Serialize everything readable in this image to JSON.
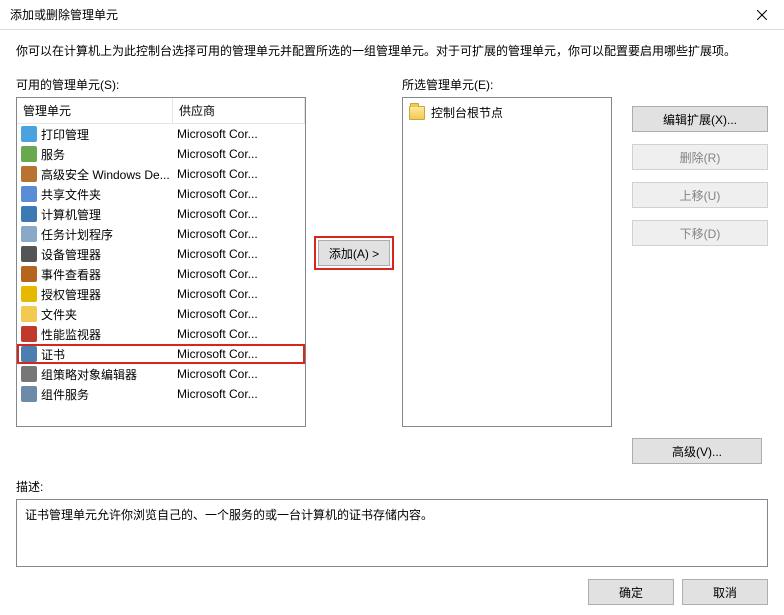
{
  "title": "添加或删除管理单元",
  "intro": "你可以在计算机上为此控制台选择可用的管理单元并配置所选的一组管理单元。对于可扩展的管理单元，你可以配置要启用哪些扩展项。",
  "available_label": "可用的管理单元(S):",
  "selected_label": "所选管理单元(E):",
  "columns": {
    "name": "管理单元",
    "vendor": "供应商"
  },
  "snapins": [
    {
      "name": "打印管理",
      "vendor": "Microsoft Cor...",
      "iconColor": "#4aa3df",
      "selected": false
    },
    {
      "name": "服务",
      "vendor": "Microsoft Cor...",
      "iconColor": "#6aa84f",
      "selected": false
    },
    {
      "name": "高级安全 Windows De...",
      "vendor": "Microsoft Cor...",
      "iconColor": "#b87333",
      "selected": false
    },
    {
      "name": "共享文件夹",
      "vendor": "Microsoft Cor...",
      "iconColor": "#5b8dd6",
      "selected": false
    },
    {
      "name": "计算机管理",
      "vendor": "Microsoft Cor...",
      "iconColor": "#3d7ab3",
      "selected": false
    },
    {
      "name": "任务计划程序",
      "vendor": "Microsoft Cor...",
      "iconColor": "#89a9c9",
      "selected": false
    },
    {
      "name": "设备管理器",
      "vendor": "Microsoft Cor...",
      "iconColor": "#555555",
      "selected": false
    },
    {
      "name": "事件查看器",
      "vendor": "Microsoft Cor...",
      "iconColor": "#b5651d",
      "selected": false
    },
    {
      "name": "授权管理器",
      "vendor": "Microsoft Cor...",
      "iconColor": "#e6b800",
      "selected": false
    },
    {
      "name": "文件夹",
      "vendor": "Microsoft Cor...",
      "iconColor": "#f2ca4f",
      "selected": false
    },
    {
      "name": "性能监视器",
      "vendor": "Microsoft Cor...",
      "iconColor": "#c0392b",
      "selected": false
    },
    {
      "name": "证书",
      "vendor": "Microsoft Cor...",
      "iconColor": "#4a7fb0",
      "selected": true
    },
    {
      "name": "组策略对象编辑器",
      "vendor": "Microsoft Cor...",
      "iconColor": "#777777",
      "selected": false
    },
    {
      "name": "组件服务",
      "vendor": "Microsoft Cor...",
      "iconColor": "#6d8aa8",
      "selected": false
    }
  ],
  "selected_root": "控制台根节点",
  "buttons": {
    "add": "添加(A) >",
    "edit_ext": "编辑扩展(X)...",
    "remove": "删除(R)",
    "move_up": "上移(U)",
    "move_down": "下移(D)",
    "advanced": "高级(V)...",
    "ok": "确定",
    "cancel": "取消"
  },
  "description_label": "描述:",
  "description": "证书管理单元允许你浏览自己的、一个服务的或一台计算机的证书存储内容。"
}
